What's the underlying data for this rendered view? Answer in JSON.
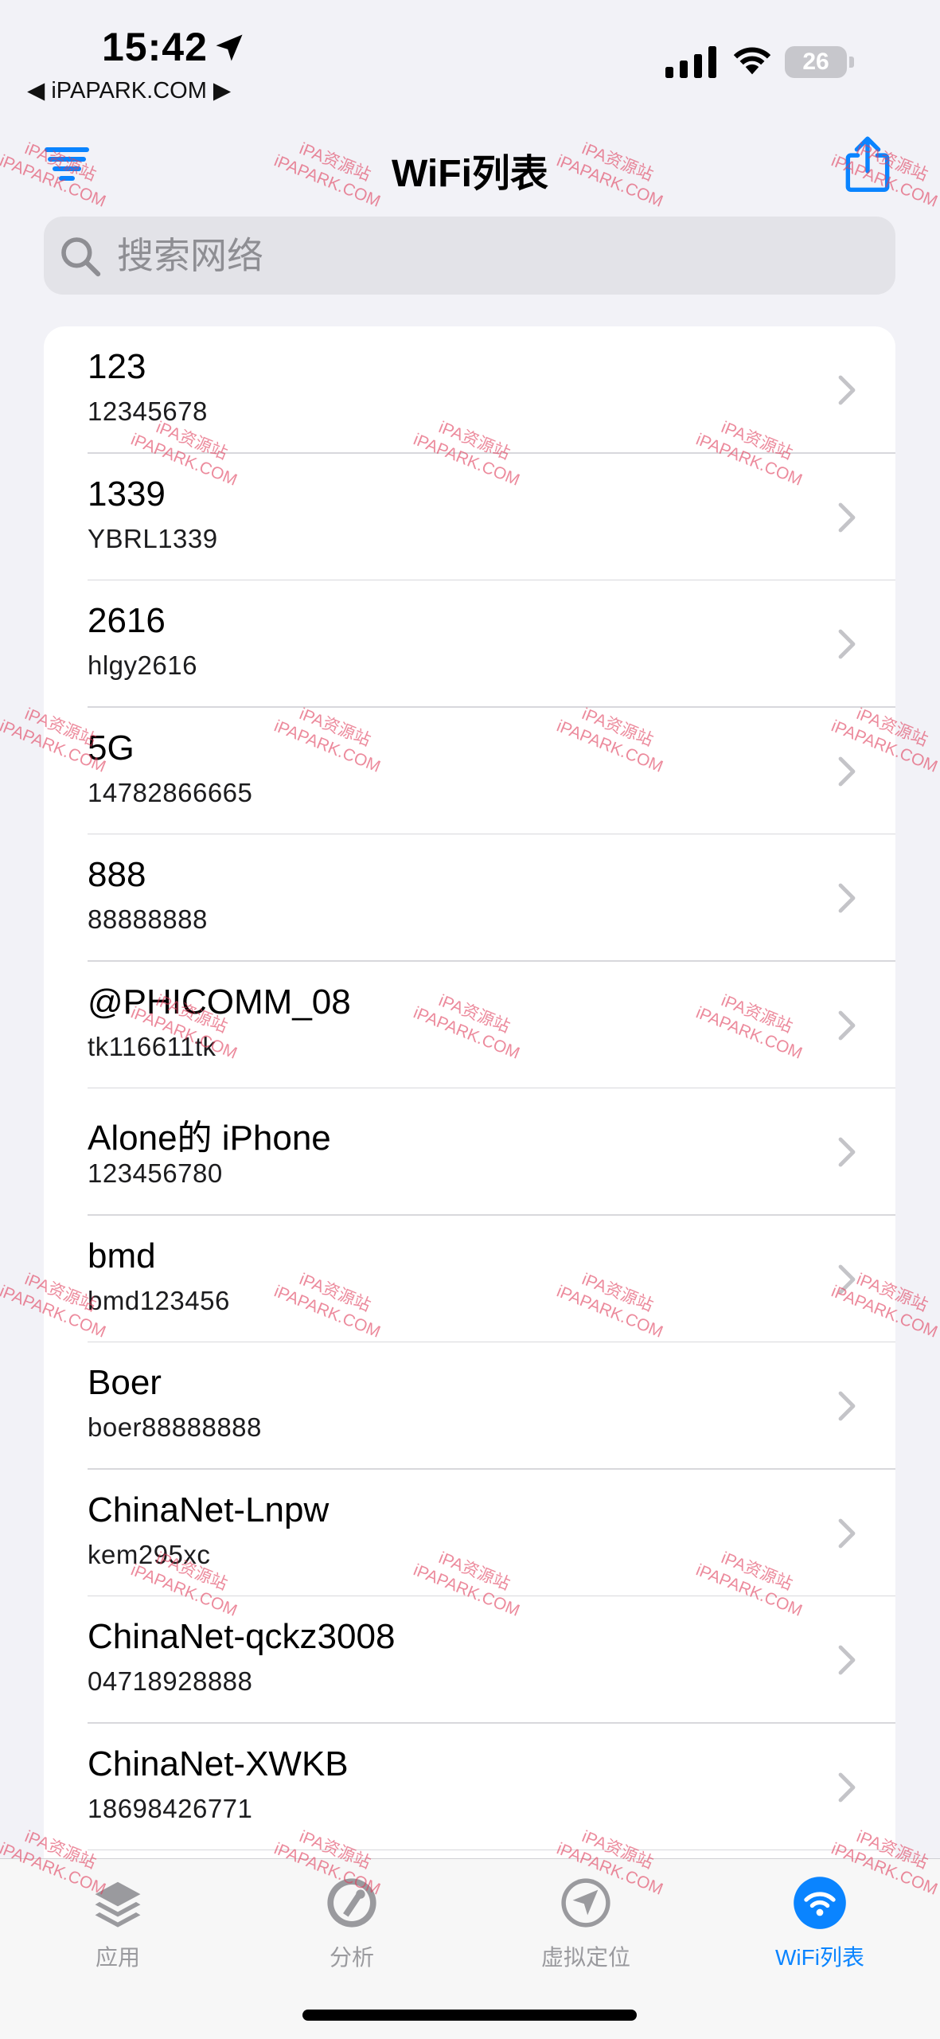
{
  "status_bar": {
    "time": "15:42",
    "back_app": "◀ iPAPARK.COM ▶",
    "battery": "26"
  },
  "nav": {
    "title": "WiFi列表"
  },
  "search": {
    "placeholder": "搜索网络",
    "value": ""
  },
  "networks": [
    {
      "name": "123",
      "password": "12345678"
    },
    {
      "name": "1339",
      "password": "YBRL1339"
    },
    {
      "name": "2616",
      "password": "hlgy2616"
    },
    {
      "name": "5G",
      "password": "14782866665"
    },
    {
      "name": "888",
      "password": "88888888"
    },
    {
      "name": "@PHICOMM_08",
      "password": "tk116611tk"
    },
    {
      "name": "Alone的 iPhone",
      "password": "123456780"
    },
    {
      "name": "bmd",
      "password": "bmd123456"
    },
    {
      "name": "Boer",
      "password": "boer88888888"
    },
    {
      "name": "ChinaNet-Lnpw",
      "password": "kem295xc"
    },
    {
      "name": "ChinaNet-qckz3008",
      "password": "04718928888"
    },
    {
      "name": "ChinaNet-XWKB",
      "password": "18698426771"
    }
  ],
  "tabs": [
    {
      "label": "应用",
      "icon": "stack-icon",
      "active": false
    },
    {
      "label": "分析",
      "icon": "analysis-icon",
      "active": false
    },
    {
      "label": "虚拟定位",
      "icon": "location-icon",
      "active": false
    },
    {
      "label": "WiFi列表",
      "icon": "wifi-icon",
      "active": true
    }
  ],
  "watermark": {
    "line1": "iPA资源站",
    "line2": "iPAPARK.COM"
  },
  "colors": {
    "accent": "#0a84ff",
    "background": "#f2f2f7",
    "watermark": "#e03c5a"
  }
}
